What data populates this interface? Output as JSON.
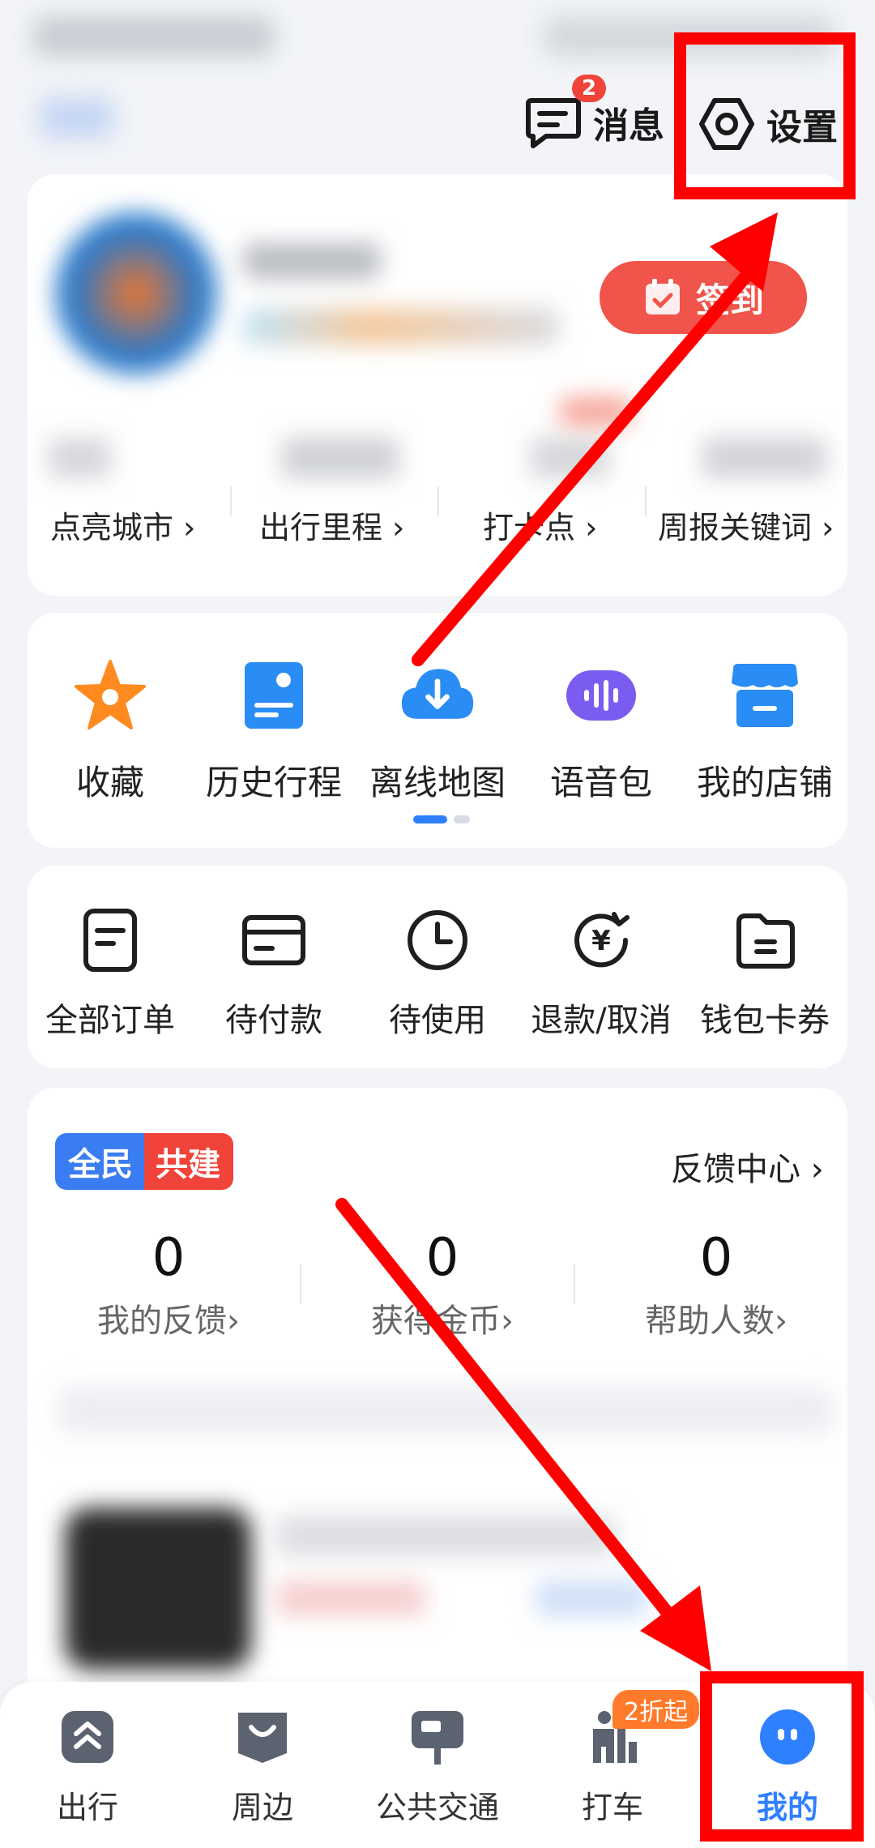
{
  "header": {
    "messages_label": "消息",
    "messages_badge": "2",
    "settings_label": "设置"
  },
  "profile": {
    "checkin_label": "签到"
  },
  "stats": [
    {
      "label": "点亮城市 ›"
    },
    {
      "label": "出行里程 ›"
    },
    {
      "label": "打卡点 ›"
    },
    {
      "label": "周报关键词 ›"
    }
  ],
  "tools": [
    {
      "label": "收藏",
      "icon": "star-icon"
    },
    {
      "label": "历史行程",
      "icon": "history-route-icon"
    },
    {
      "label": "离线地图",
      "icon": "cloud-download-icon"
    },
    {
      "label": "语音包",
      "icon": "voice-pack-icon"
    },
    {
      "label": "我的店铺",
      "icon": "store-icon"
    }
  ],
  "orders": [
    {
      "label": "全部订单",
      "icon": "order-icon"
    },
    {
      "label": "待付款",
      "icon": "card-icon"
    },
    {
      "label": "待使用",
      "icon": "clock-icon"
    },
    {
      "label": "退款/取消",
      "icon": "refund-icon"
    },
    {
      "label": "钱包卡券",
      "icon": "wallet-icon"
    }
  ],
  "feedback": {
    "tag_left": "全民",
    "tag_right": "共建",
    "center_link": "反馈中心 ›",
    "items": [
      {
        "value": "0",
        "label": "我的反馈›"
      },
      {
        "value": "0",
        "label": "获得金币›"
      },
      {
        "value": "0",
        "label": "帮助人数›"
      }
    ]
  },
  "nav": {
    "items": [
      {
        "label": "出行",
        "icon": "travel-icon"
      },
      {
        "label": "周边",
        "icon": "nearby-icon"
      },
      {
        "label": "公共交通",
        "icon": "bus-icon"
      },
      {
        "label": "打车",
        "icon": "taxi-icon",
        "badge": "2折起"
      },
      {
        "label": "我的",
        "icon": "profile-icon",
        "active": true
      }
    ]
  },
  "colors": {
    "accent_blue": "#2f80ff",
    "annotation_red": "#ff0000",
    "checkin_red": "#f0544a"
  }
}
